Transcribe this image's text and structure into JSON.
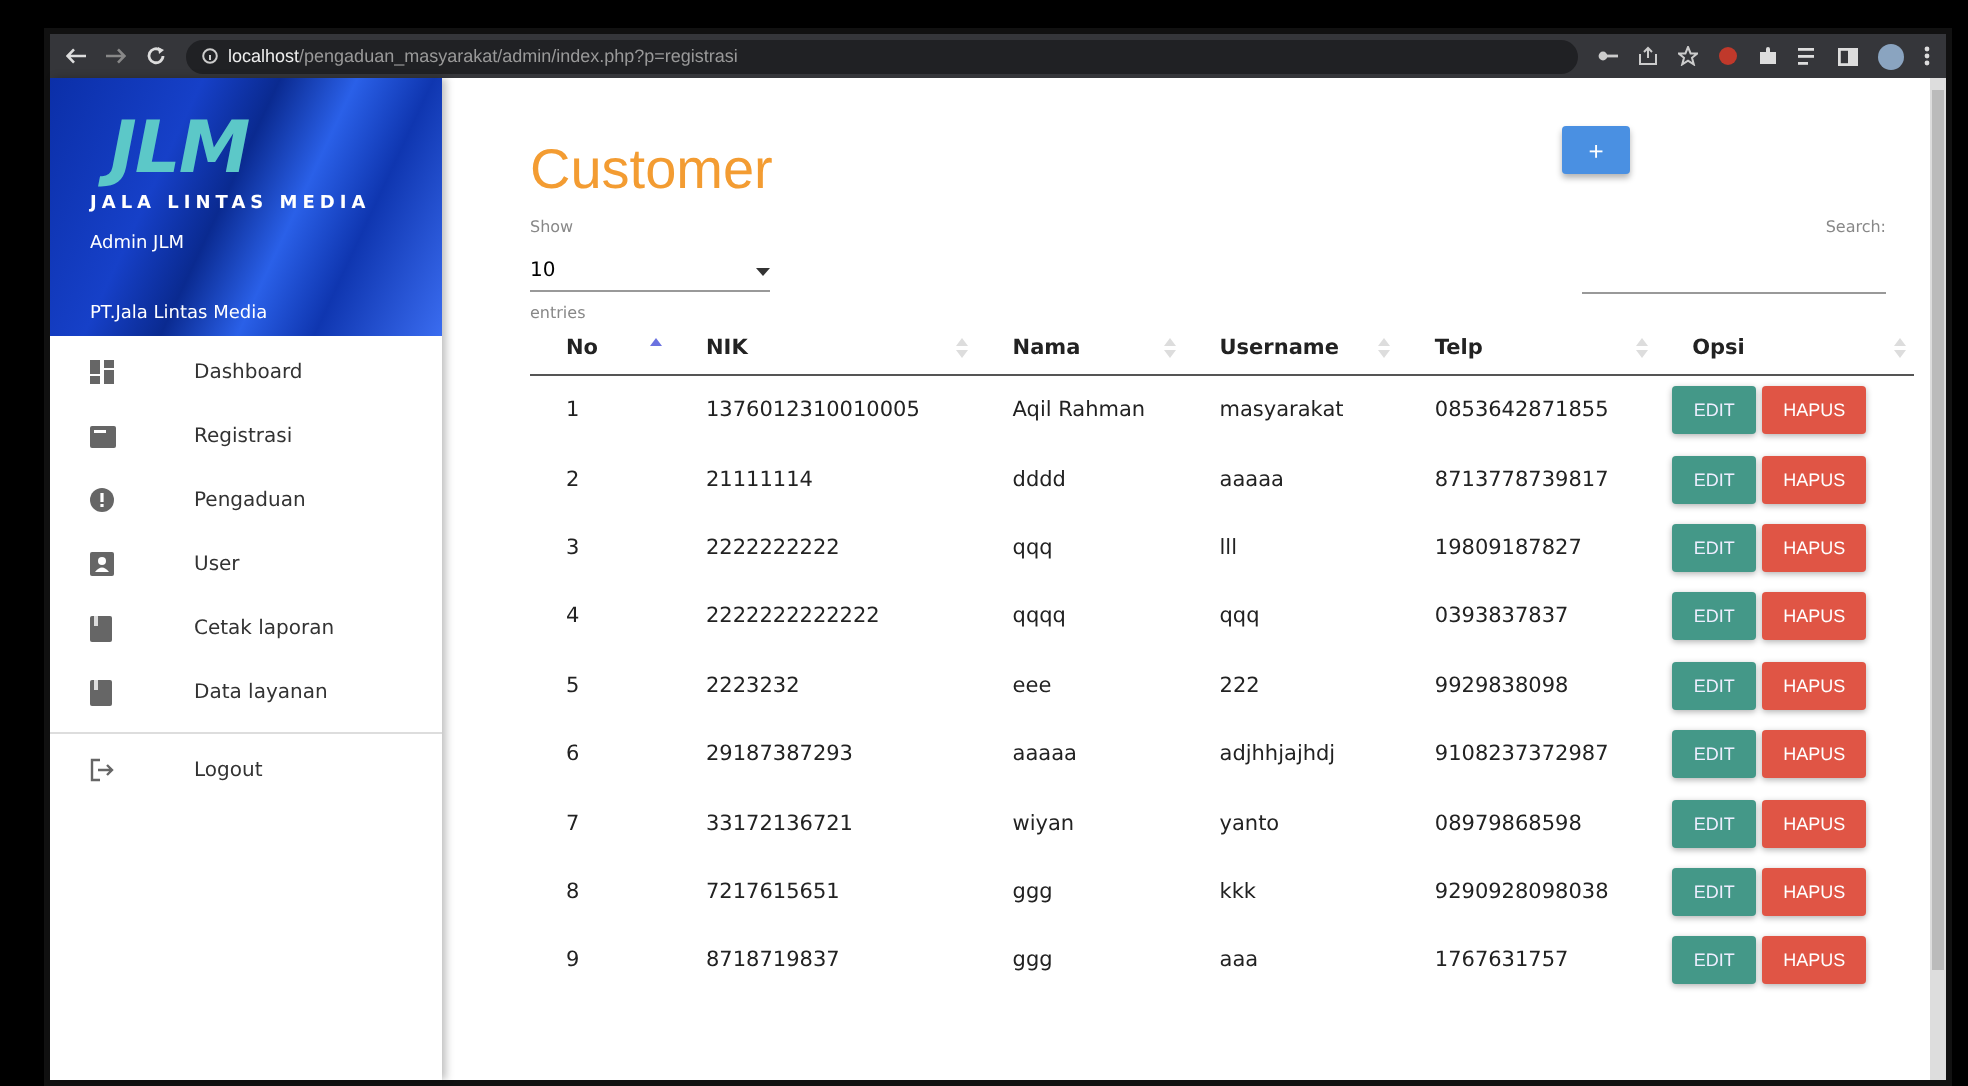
{
  "browser": {
    "url_host": "localhost",
    "url_path": "/pengaduan_masyarakat/admin/index.php?p=registrasi"
  },
  "sidebar": {
    "logo_text": "JLM",
    "brand": "JALA LINTAS MEDIA",
    "user": "Admin JLM",
    "company": "PT.Jala Lintas Media",
    "items": [
      {
        "label": "Dashboard",
        "kind": "dashboard"
      },
      {
        "label": "Registrasi",
        "kind": "card"
      },
      {
        "label": "Pengaduan",
        "kind": "alert"
      },
      {
        "label": "User",
        "kind": "user"
      },
      {
        "label": "Cetak laporan",
        "kind": "book"
      },
      {
        "label": "Data layanan",
        "kind": "book"
      }
    ],
    "logout": "Logout"
  },
  "page": {
    "title": "Customer",
    "add_button": "+",
    "show_label": "Show",
    "show_value": "10",
    "entries_label": "entries",
    "search_label": "Search:"
  },
  "table": {
    "columns": [
      {
        "label": "No",
        "sorted": true
      },
      {
        "label": "NIK",
        "sorted": false
      },
      {
        "label": "Nama",
        "sorted": false
      },
      {
        "label": "Username",
        "sorted": false
      },
      {
        "label": "Telp",
        "sorted": false
      },
      {
        "label": "Opsi",
        "sorted": false
      }
    ],
    "rows": [
      {
        "no": "1",
        "nik": "1376012310010005",
        "nama": "Aqil Rahman",
        "username": "masyarakat",
        "telp": "0853642871855",
        "edit": "EDIT",
        "hapus": "HAPUS"
      },
      {
        "no": "2",
        "nik": "21111114",
        "nama": "dddd",
        "username": "aaaaa",
        "telp": "8713778739817",
        "edit": "EDIT",
        "hapus": "HAPUS"
      },
      {
        "no": "3",
        "nik": "2222222222",
        "nama": "qqq",
        "username": "lll",
        "telp": "19809187827",
        "edit": "EDIT",
        "hapus": "HAPUS"
      },
      {
        "no": "4",
        "nik": "2222222222222",
        "nama": "qqqq",
        "username": "qqq",
        "telp": "0393837837",
        "edit": "EDIT",
        "hapus": "HAPUS"
      },
      {
        "no": "5",
        "nik": "2223232",
        "nama": "eee",
        "username": "222",
        "telp": "9929838098",
        "edit": "EDIT",
        "hapus": "HAPUS"
      },
      {
        "no": "6",
        "nik": "29187387293",
        "nama": "aaaaa",
        "username": "adjhhjajhdj",
        "telp": "9108237372987",
        "edit": "EDIT",
        "hapus": "HAPUS"
      },
      {
        "no": "7",
        "nik": "33172136721",
        "nama": "wiyan",
        "username": "yanto",
        "telp": "08979868598",
        "edit": "EDIT",
        "hapus": "HAPUS"
      },
      {
        "no": "8",
        "nik": "7217615651",
        "nama": "ggg",
        "username": "kkk",
        "telp": "9290928098038",
        "edit": "EDIT",
        "hapus": "HAPUS"
      },
      {
        "no": "9",
        "nik": "8718719837",
        "nama": "ggg",
        "username": "aaa",
        "telp": "1767631757",
        "edit": "EDIT",
        "hapus": "HAPUS"
      }
    ]
  }
}
